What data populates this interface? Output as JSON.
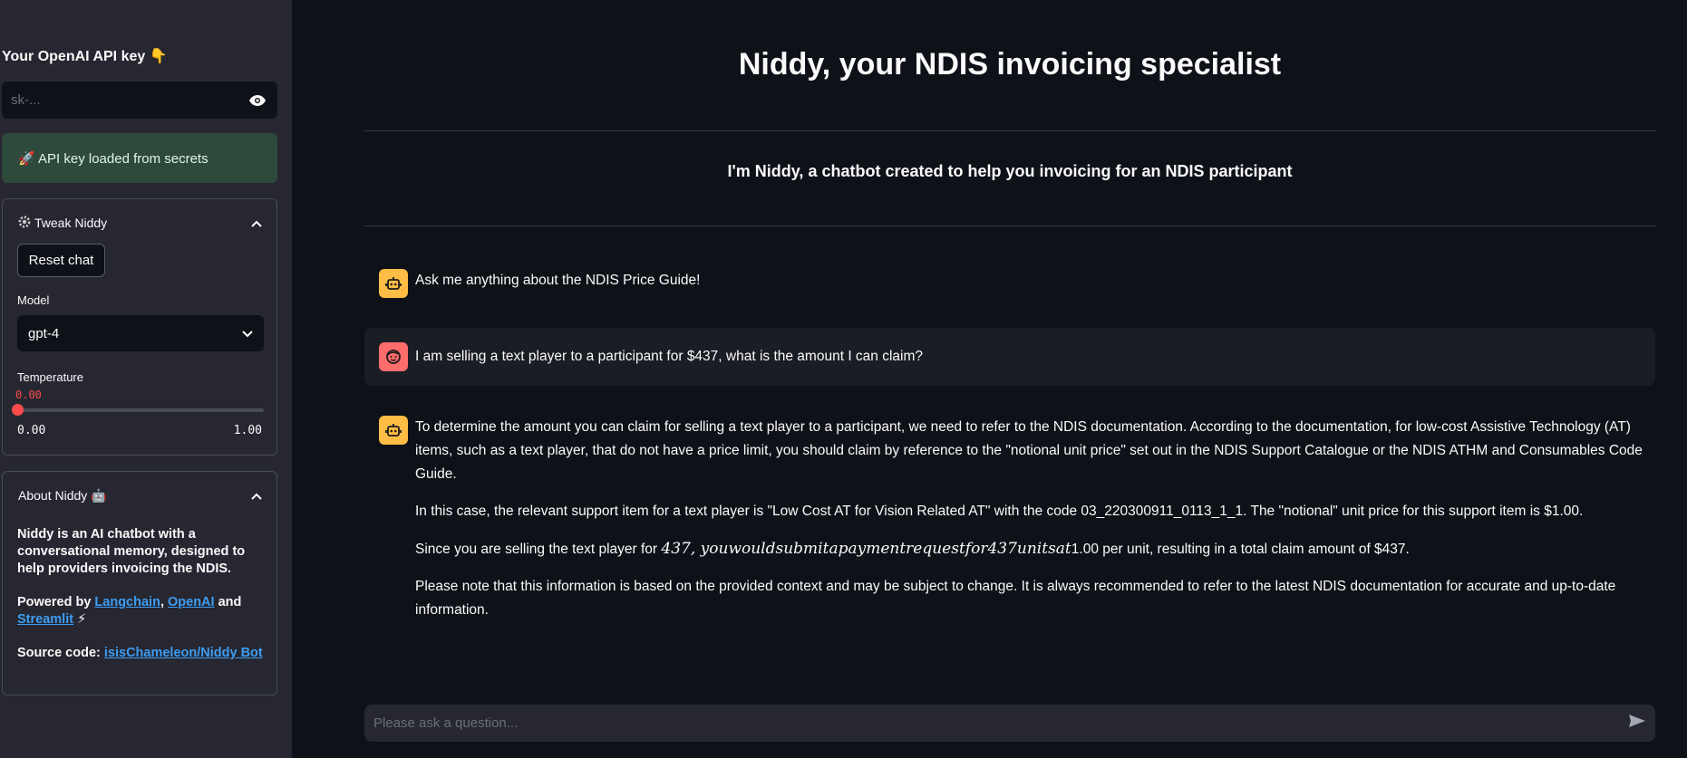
{
  "sidebar": {
    "api_key_label": "Your OpenAI API key 👇",
    "api_key_placeholder": "sk-...",
    "api_success": "🚀 API key loaded from secrets",
    "tweak": {
      "header": "Tweak Niddy",
      "reset_label": "Reset chat",
      "model_label": "Model",
      "model_value": "gpt-4",
      "temperature_label": "Temperature",
      "temperature_value": "0.00",
      "temperature_level": 0.0,
      "temperature_min": "0.00",
      "temperature_max": "1.00"
    },
    "about": {
      "header": "About Niddy 🤖",
      "description": "Niddy is an AI chatbot with a conversational memory, designed to help providers invoicing the NDIS.",
      "powered_prefix": "Powered by ",
      "link_langchain": "Langchain",
      "sep": ", ",
      "link_openai": "OpenAI",
      "and": " and ",
      "link_streamlit": "Streamlit",
      "powered_suffix": " ⚡",
      "source_prefix": "Source code: ",
      "link_source": "isisChameleon/Niddy Bot"
    }
  },
  "main": {
    "title": "Niddy, your NDIS invoicing specialist",
    "subtitle": "I'm Niddy, a chatbot created to help you invoicing for an NDIS participant",
    "messages": [
      {
        "role": "assistant",
        "text": "Ask me anything about the NDIS Price Guide!"
      },
      {
        "role": "user",
        "text": "I am selling a text player to a participant for $437, what is the amount I can claim?"
      },
      {
        "role": "assistant",
        "paragraphs": [
          "To determine the amount you can claim for selling a text player to a participant, we need to refer to the NDIS documentation. According to the documentation, for low-cost Assistive Technology (AT) items, such as a text player, that do not have a price limit, you should claim by reference to the \"notional unit price\" set out in the NDIS Support Catalogue or the NDIS ATHM and Consumables Code Guide.",
          "In this case, the relevant support item for a text player is \"Low Cost AT for Vision Related AT\" with the code 03_220300911_0113_1_1. The \"notional\" unit price for this support item is $1.00."
        ],
        "p3_prefix": "Since you are selling the text player for ",
        "p3_math": "437, youwouldsubmitapaymentrequestfor437unitsat",
        "p3_suffix": "1.00 per unit, resulting in a total claim amount of $437.",
        "p4": "Please note that this information is based on the provided context and may be subject to change. It is always recommended to refer to the latest NDIS documentation for accurate and up-to-date information."
      }
    ],
    "chat_placeholder": "Please ask a question..."
  },
  "icons": {
    "eye": "eye-icon",
    "gear": "gear-icon",
    "chevron": "chevron-up-icon",
    "select_arrow": "chevron-down-icon",
    "bot_avatar": "robot-icon",
    "user_avatar": "face-icon",
    "send": "send-icon"
  },
  "colors": {
    "accent": "#ff4b4b",
    "link": "#3d9df3",
    "bot_avatar": "#ffbd45",
    "user_avatar": "#ff6c6c",
    "success_bg": "#2e4a3c"
  }
}
